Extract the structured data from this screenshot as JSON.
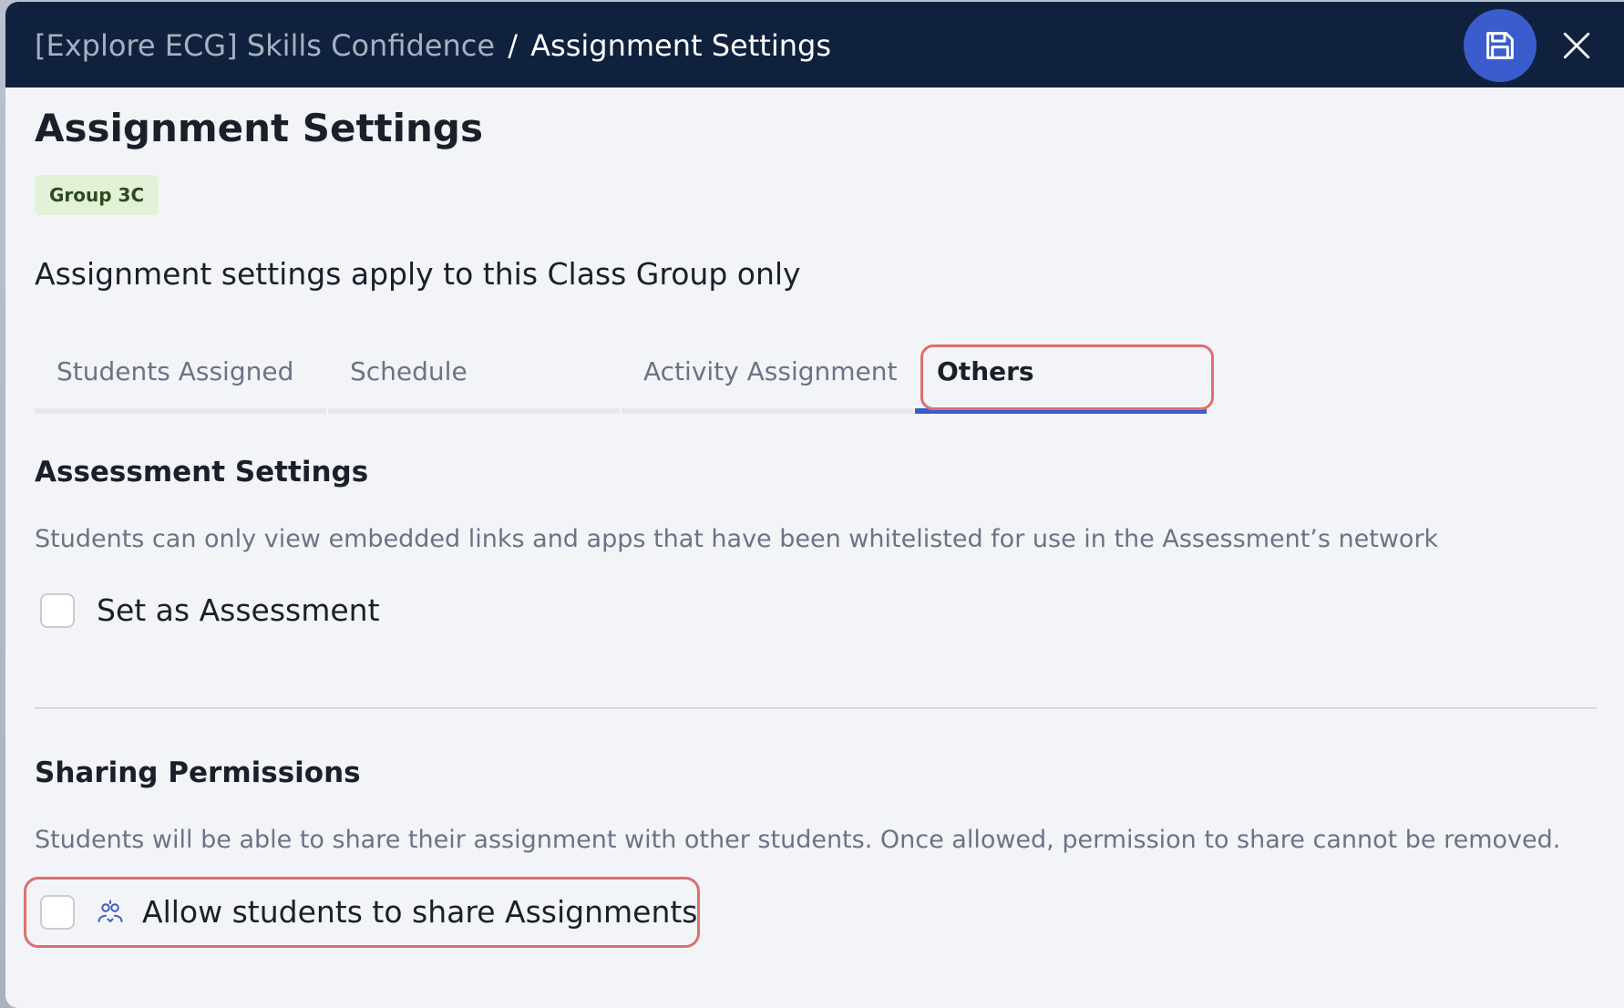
{
  "header": {
    "breadcrumb_parent": "[Explore ECG] Skills Confidence",
    "breadcrumb_separator": "/",
    "breadcrumb_current": "Assignment Settings",
    "save_icon": "save-icon",
    "close_icon": "close-icon"
  },
  "main": {
    "title": "Assignment Settings",
    "group_badge": "Group 3C",
    "subtitle": "Assignment settings apply to this Class Group only"
  },
  "tabs": [
    {
      "label": "Students Assigned",
      "active": false
    },
    {
      "label": "Schedule",
      "active": false
    },
    {
      "label": "Activity Assignment",
      "active": false
    },
    {
      "label": "Others",
      "active": true
    }
  ],
  "assessment": {
    "title": "Assessment Settings",
    "description": "Students can only view embedded links and apps that have been whitelisted for use in the Assessment’s network",
    "checkbox_label": "Set as Assessment",
    "checked": false
  },
  "sharing": {
    "title": "Sharing Permissions",
    "description": "Students will be able to share their assignment with other students. Once allowed, permission to share cannot be removed.",
    "checkbox_label": "Allow students to share Assignments",
    "checked": false,
    "icon": "share-users-icon"
  },
  "colors": {
    "header_bg": "#10213d",
    "accent": "#3b5ccc",
    "highlight": "#dd6f6f",
    "badge_bg": "#e3f2d6"
  }
}
